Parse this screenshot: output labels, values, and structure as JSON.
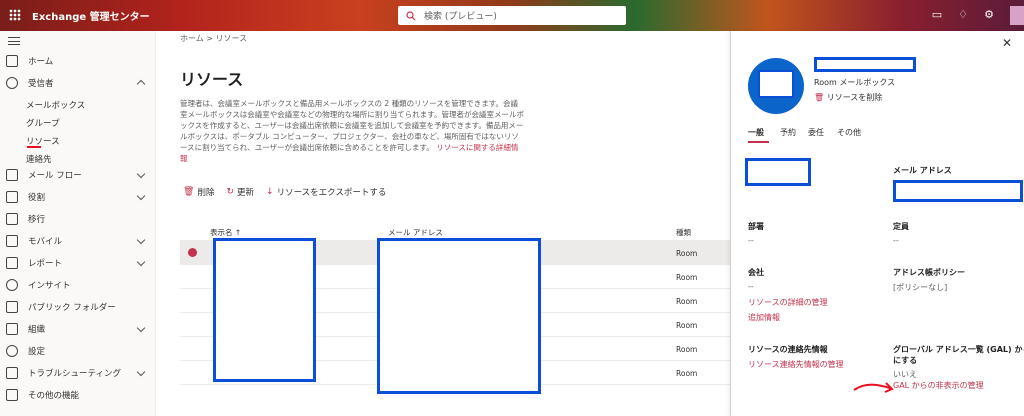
{
  "topbar": {
    "title": "Exchange 管理センター",
    "search_placeholder": "検索 (プレビュー)"
  },
  "sidebar": {
    "items": [
      {
        "label": "ホーム"
      },
      {
        "label": "受信者"
      },
      {
        "label": "メール フロー"
      },
      {
        "label": "役割"
      },
      {
        "label": "移行"
      },
      {
        "label": "モバイル"
      },
      {
        "label": "レポート"
      },
      {
        "label": "インサイト"
      },
      {
        "label": "パブリック フォルダー"
      },
      {
        "label": "組織"
      },
      {
        "label": "設定"
      },
      {
        "label": "トラブルシューティング"
      },
      {
        "label": "その他の機能"
      }
    ],
    "recipients_sub": [
      "メールボックス",
      "グループ",
      "リソース",
      "連絡先"
    ]
  },
  "main": {
    "breadcrumb": "ホーム  >  リソース",
    "title": "リソース",
    "description": "管理者は、会議室メールボックスと備品用メールボックスの 2 種類のリソースを管理できます。会議室メールボックスは会議室や会議室などの物理的な場所に割り当てられます。管理者が会議室メールボックスを作成すると、ユーザーは会議出席依頼に会議室を追加して会議室を予約できます。備品用メールボックスは、ポータブル コンピューター、プロジェクター、会社の車など、場所固有ではないリソースに割り当てられ、ユーザーが会議出席依頼に含めることを許可します。",
    "description_link": "リソースに関する詳細情報",
    "toolbar": {
      "delete": "削除",
      "refresh": "更新",
      "export": "リソースをエクスポートする"
    },
    "table": {
      "headers": [
        "表示名 ↑",
        "メール アドレス",
        "種類"
      ],
      "rows": [
        {
          "type": "Room"
        },
        {
          "type": "Room"
        },
        {
          "type": "Room"
        },
        {
          "type": "Room"
        },
        {
          "type": "Room"
        },
        {
          "type": "Room"
        }
      ]
    }
  },
  "panel": {
    "subtitle": "Room メールボックス",
    "delete_resource": "リソースを削除",
    "tabs": [
      "一般",
      "予約",
      "委任",
      "その他"
    ],
    "mail_label": "メール アドレス",
    "dept_label": "部署",
    "dept_value": "--",
    "capacity_label": "定員",
    "capacity_value": "--",
    "company_label": "会社",
    "company_value": "--",
    "address_policy_label": "アドレス帳ポリシー",
    "address_policy_value": "[ポリシーなし]",
    "manage_details": "リソースの詳細の管理",
    "more_info": "追加情報",
    "contact_label": "リソースの連絡先情報",
    "manage_contact": "リソース連絡先情報の管理",
    "gal_label_1": "グローバル アドレス一覧 (GAL) から非表示",
    "gal_label_2": "にする",
    "gal_value": "いいえ",
    "gal_manage": "GAL からの非表示の管理"
  },
  "colors": {
    "accent": "#c4314b",
    "redaction": "#0b4fd6"
  }
}
